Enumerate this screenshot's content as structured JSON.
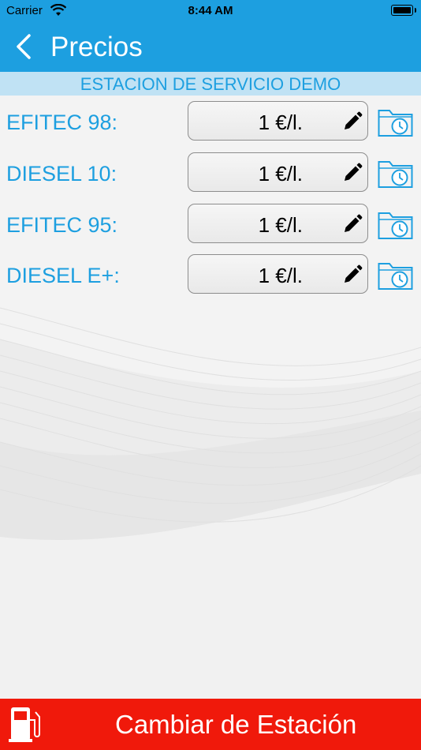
{
  "status_bar": {
    "carrier": "Carrier",
    "time": "8:44 AM"
  },
  "nav": {
    "title": "Precios"
  },
  "station": {
    "name": "ESTACION DE SERVICIO DEMO"
  },
  "fuels": [
    {
      "label": "EFITEC 98:",
      "price": "1 €/l."
    },
    {
      "label": "DIESEL 10:",
      "price": "1 €/l."
    },
    {
      "label": "EFITEC 95:",
      "price": "1 €/l."
    },
    {
      "label": "DIESEL E+:",
      "price": "1 €/l."
    }
  ],
  "bottom_bar": {
    "label": "Cambiar de Estación"
  },
  "colors": {
    "primary": "#1d9fe0",
    "station_band": "#c0e2f4",
    "action": "#f0190b"
  }
}
